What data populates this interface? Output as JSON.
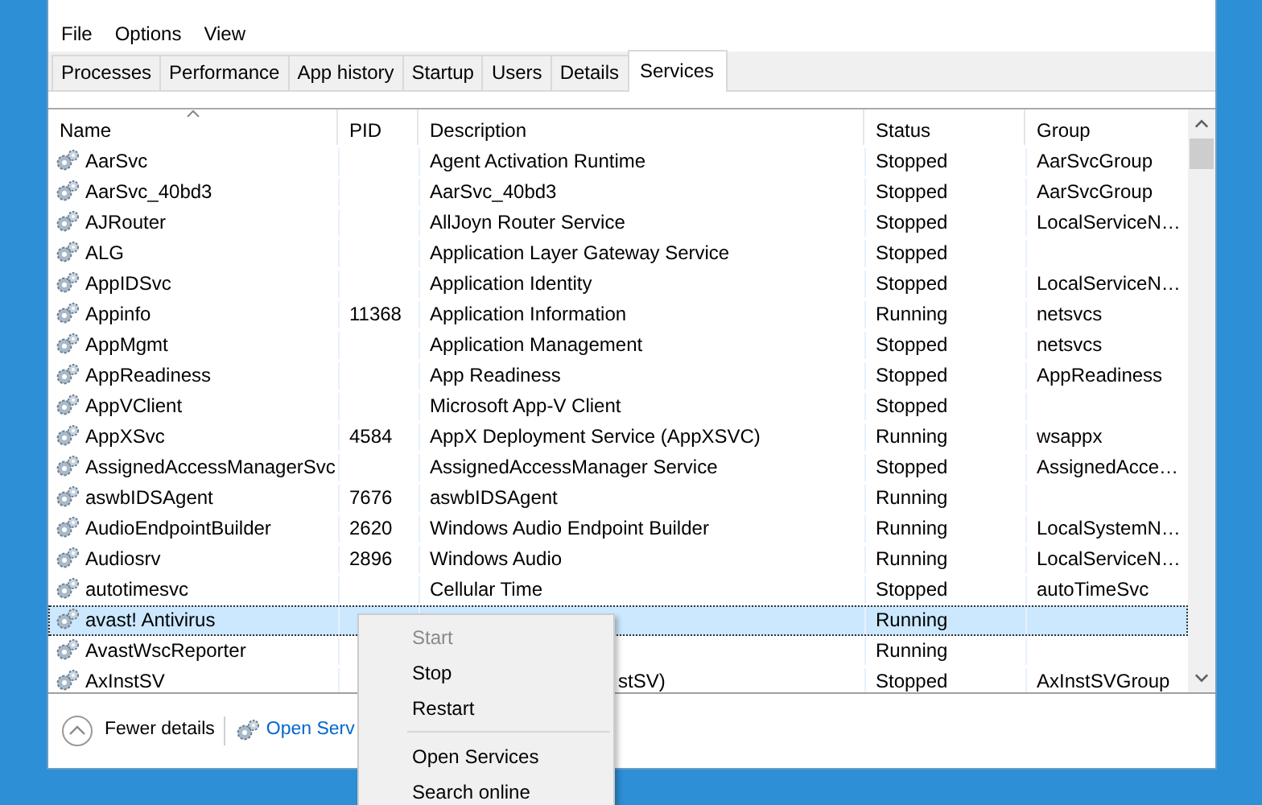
{
  "menu_bar": [
    "File",
    "Options",
    "View"
  ],
  "tabs": [
    {
      "label": "Processes",
      "selected": false
    },
    {
      "label": "Performance",
      "selected": false
    },
    {
      "label": "App history",
      "selected": false
    },
    {
      "label": "Startup",
      "selected": false
    },
    {
      "label": "Users",
      "selected": false
    },
    {
      "label": "Details",
      "selected": false
    },
    {
      "label": "Services",
      "selected": true
    }
  ],
  "table": {
    "columns": [
      "Name",
      "PID",
      "Description",
      "Status",
      "Group"
    ],
    "rows": [
      {
        "name": "AarSvc",
        "pid": "",
        "description": "Agent Activation Runtime",
        "status": "Stopped",
        "group": "AarSvcGroup",
        "selected": false
      },
      {
        "name": "AarSvc_40bd3",
        "pid": "",
        "description": "AarSvc_40bd3",
        "status": "Stopped",
        "group": "AarSvcGroup",
        "selected": false
      },
      {
        "name": "AJRouter",
        "pid": "",
        "description": "AllJoyn Router Service",
        "status": "Stopped",
        "group": "LocalServiceN…",
        "selected": false
      },
      {
        "name": "ALG",
        "pid": "",
        "description": "Application Layer Gateway Service",
        "status": "Stopped",
        "group": "",
        "selected": false
      },
      {
        "name": "AppIDSvc",
        "pid": "",
        "description": "Application Identity",
        "status": "Stopped",
        "group": "LocalServiceN…",
        "selected": false
      },
      {
        "name": "Appinfo",
        "pid": "11368",
        "description": "Application Information",
        "status": "Running",
        "group": "netsvcs",
        "selected": false
      },
      {
        "name": "AppMgmt",
        "pid": "",
        "description": "Application Management",
        "status": "Stopped",
        "group": "netsvcs",
        "selected": false
      },
      {
        "name": "AppReadiness",
        "pid": "",
        "description": "App Readiness",
        "status": "Stopped",
        "group": "AppReadiness",
        "selected": false
      },
      {
        "name": "AppVClient",
        "pid": "",
        "description": "Microsoft App-V Client",
        "status": "Stopped",
        "group": "",
        "selected": false
      },
      {
        "name": "AppXSvc",
        "pid": "4584",
        "description": "AppX Deployment Service (AppXSVC)",
        "status": "Running",
        "group": "wsappx",
        "selected": false
      },
      {
        "name": "AssignedAccessManagerSvc",
        "pid": "",
        "description": "AssignedAccessManager Service",
        "status": "Stopped",
        "group": "AssignedAcce…",
        "selected": false
      },
      {
        "name": "aswbIDSAgent",
        "pid": "7676",
        "description": "aswbIDSAgent",
        "status": "Running",
        "group": "",
        "selected": false
      },
      {
        "name": "AudioEndpointBuilder",
        "pid": "2620",
        "description": "Windows Audio Endpoint Builder",
        "status": "Running",
        "group": "LocalSystemN…",
        "selected": false
      },
      {
        "name": "Audiosrv",
        "pid": "2896",
        "description": "Windows Audio",
        "status": "Running",
        "group": "LocalServiceN…",
        "selected": false
      },
      {
        "name": "autotimesvc",
        "pid": "",
        "description": "Cellular Time",
        "status": "Stopped",
        "group": "autoTimeSvc",
        "selected": false
      },
      {
        "name": "avast! Antivirus",
        "pid": "",
        "description": "",
        "status": "Running",
        "group": "",
        "selected": true
      },
      {
        "name": "AvastWscReporter",
        "pid": "",
        "description": "",
        "status": "Running",
        "group": "",
        "selected": false
      },
      {
        "name": "AxInstSV",
        "pid": "",
        "description": "stSV)",
        "description_partial": true,
        "status": "Stopped",
        "group": "AxInstSVGroup",
        "selected": false
      }
    ]
  },
  "footer": {
    "toggle": "Fewer details",
    "link": "Open Serv"
  },
  "context_menu": [
    {
      "label": "Start",
      "disabled": true,
      "separator_before": false
    },
    {
      "label": "Stop",
      "disabled": false,
      "separator_before": false
    },
    {
      "label": "Restart",
      "disabled": false,
      "separator_before": false
    },
    {
      "label": "Open Services",
      "disabled": false,
      "separator_before": true
    },
    {
      "label": "Search online",
      "disabled": false,
      "separator_before": false
    }
  ]
}
